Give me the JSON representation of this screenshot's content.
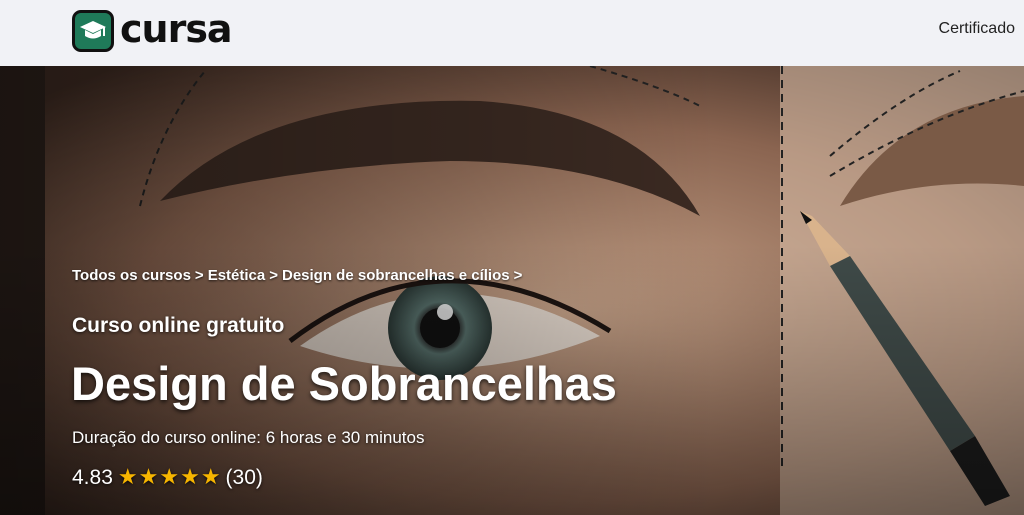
{
  "brand": {
    "name": "cursa"
  },
  "nav": {
    "certificate_link": "Certificado"
  },
  "breadcrumb": [
    "Todos os cursos",
    "Estética",
    "Design de sobrancelhas e cílios"
  ],
  "breadcrumb_separator": ">",
  "course": {
    "type_label": "Curso online gratuito",
    "title": "Design de Sobrancelhas",
    "duration": "Duração do curso online: 6 horas e 30 minutos",
    "rating": "4.83",
    "rating_stars": 5,
    "review_count": "(30)"
  },
  "colors": {
    "brand_green": "#1f7a59",
    "star": "#f7b500",
    "topbar_bg": "#f1f2f6"
  }
}
